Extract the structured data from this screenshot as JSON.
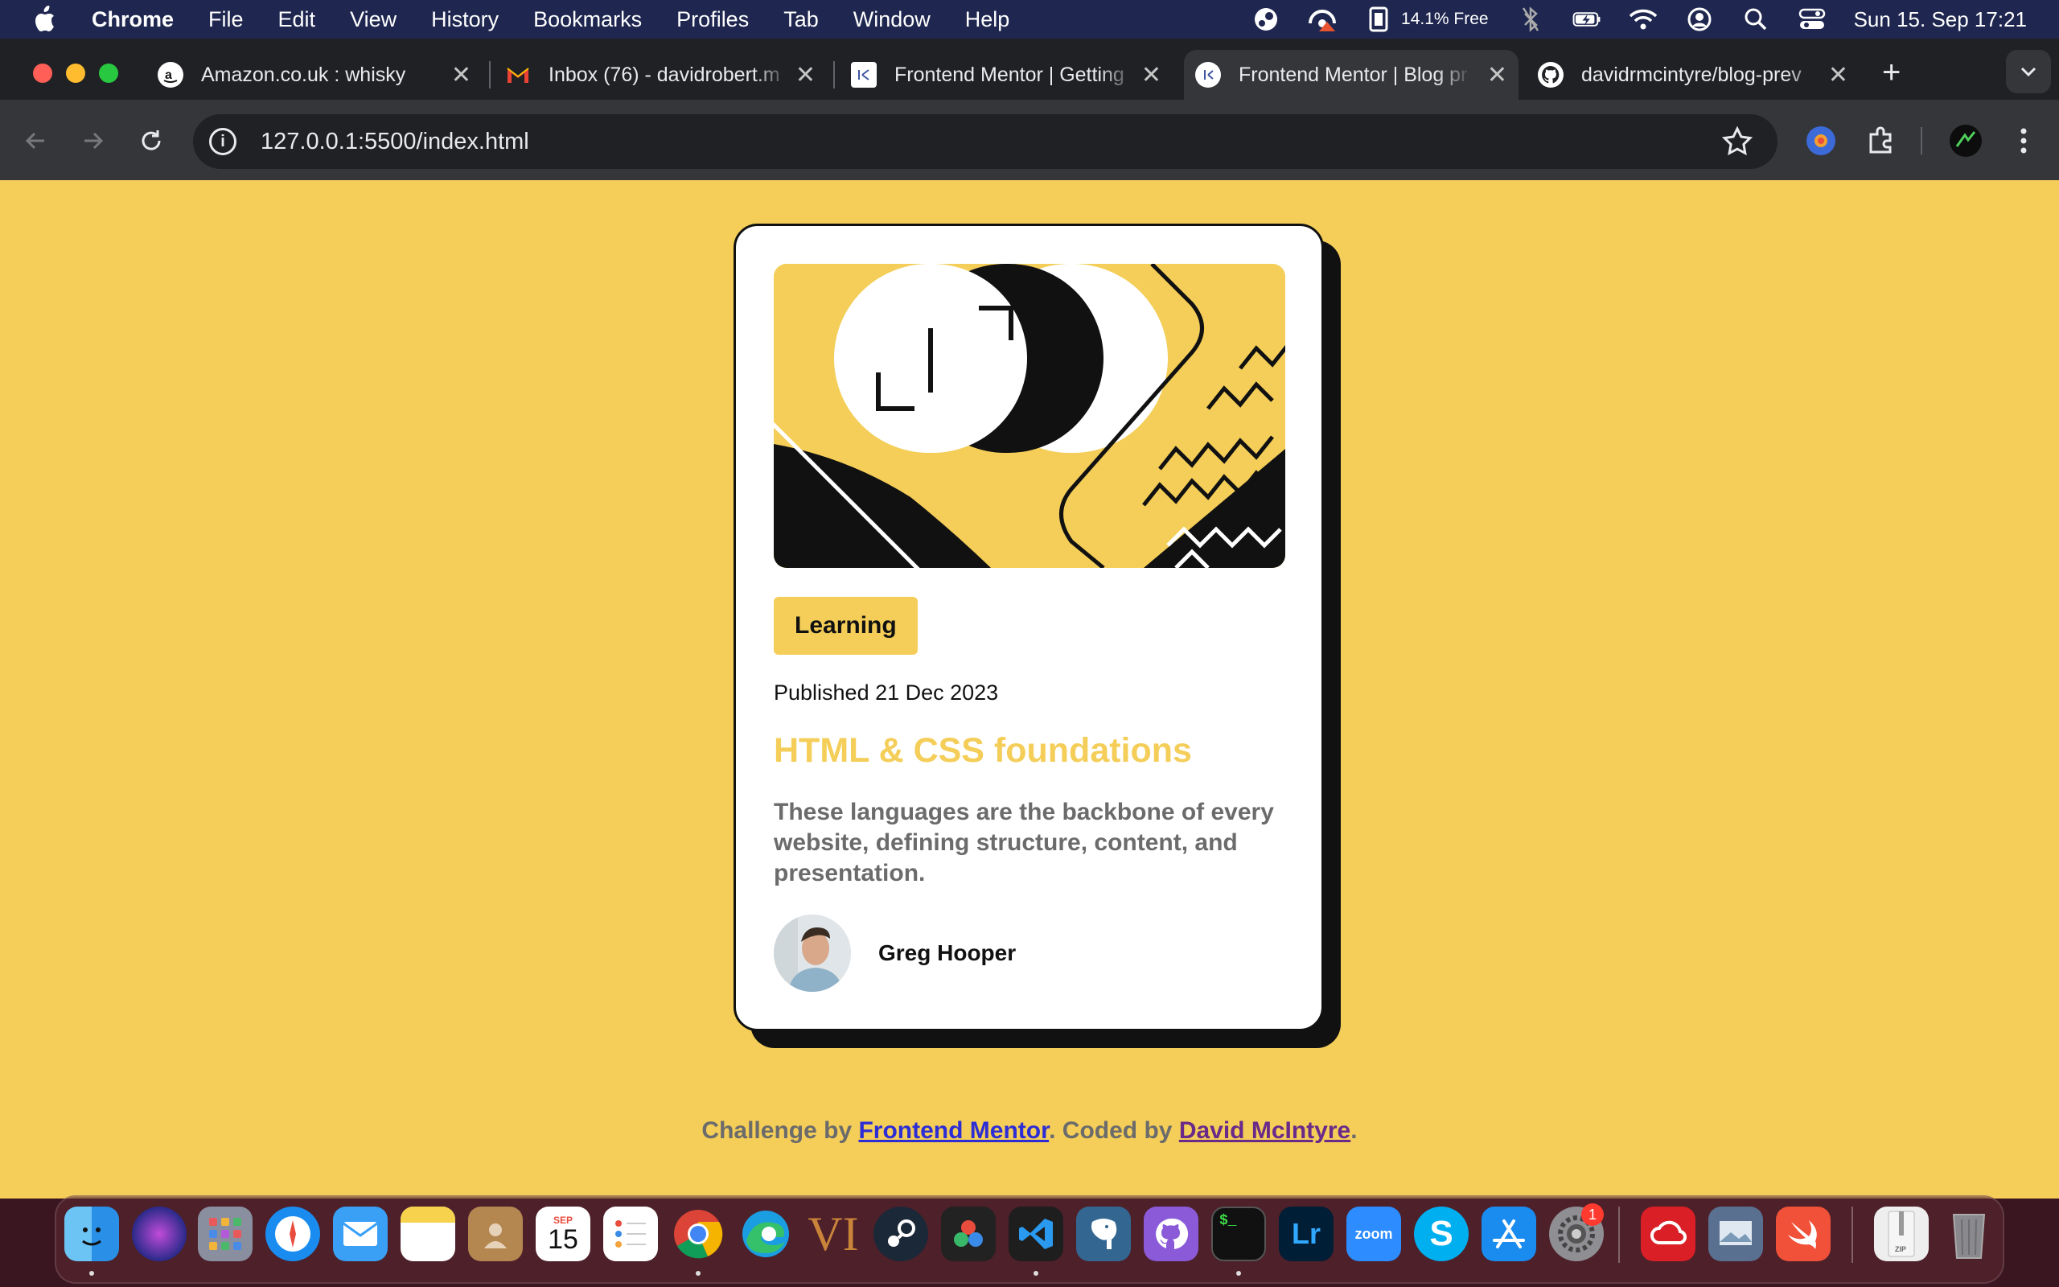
{
  "menubar": {
    "app_name": "Chrome",
    "items": [
      "File",
      "Edit",
      "View",
      "History",
      "Bookmarks",
      "Profiles",
      "Tab",
      "Window",
      "Help"
    ],
    "battery_text": "14.1% Free",
    "datetime": "Sun 15. Sep  17:21"
  },
  "tabs": [
    {
      "title": "Amazon.co.uk : whisky",
      "icon": "amazon-icon"
    },
    {
      "title": "Inbox (76) - davidrobert.m",
      "icon": "gmail-icon"
    },
    {
      "title": "Frontend Mentor | Getting",
      "icon": "frontend-mentor-icon"
    },
    {
      "title": "Frontend Mentor | Blog pr",
      "icon": "frontend-mentor-icon",
      "active": true
    },
    {
      "title": "davidrmcintyre/blog-prev",
      "icon": "github-icon"
    }
  ],
  "omnibox": {
    "url": "127.0.0.1:5500/index.html"
  },
  "card": {
    "tag": "Learning",
    "published": "Published 21 Dec 2023",
    "title": "HTML & CSS foundations",
    "summary": "These languages are the backbone of every website, defining structure, content, and presentation.",
    "author": "Greg Hooper"
  },
  "attribution": {
    "prefix": "Challenge by ",
    "link1": "Frontend Mentor",
    "middle": ". Coded by ",
    "link2": "David McIntyre",
    "suffix": "."
  },
  "dock": {
    "calendar_month": "SEP",
    "calendar_day": "15",
    "settings_badge": "1",
    "zoom_label": "zoom",
    "lightroom_label": "Lr",
    "terminal_label": "$_"
  },
  "colors": {
    "page_bg": "#f4ce58",
    "accent": "#f4ce58",
    "menubar": "#1f2750",
    "tabstrip": "#202124",
    "toolbar": "#35363a"
  }
}
